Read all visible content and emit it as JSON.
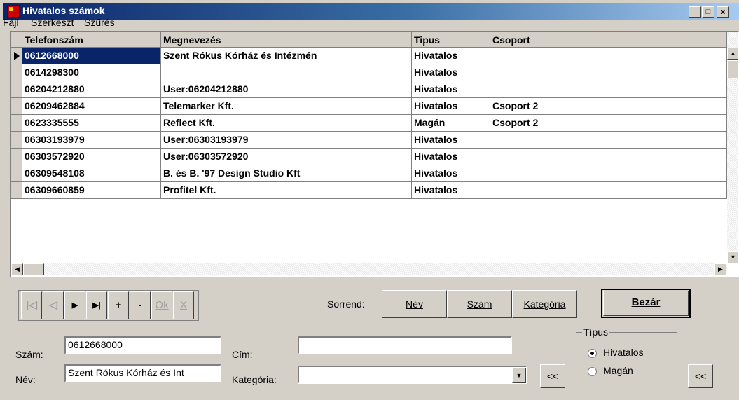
{
  "window": {
    "title": "Hivatalos számok"
  },
  "title_buttons": {
    "minimize": "_",
    "maximize": "□",
    "close": "x"
  },
  "menu": [
    "Fájl",
    "Szerkeszt",
    "Szűrés"
  ],
  "grid": {
    "headers": [
      "Telefonszám",
      "Megnevezés",
      "Tipus",
      "Csoport"
    ],
    "rows": [
      {
        "num": "0612668000",
        "name": "Szent Rókus Kórház és Intézmén",
        "type": "Hivatalos",
        "group": ""
      },
      {
        "num": "0614298300",
        "name": "",
        "type": "Hivatalos",
        "group": ""
      },
      {
        "num": "06204212880",
        "name": "User:06204212880",
        "type": "Hivatalos",
        "group": ""
      },
      {
        "num": "06209462884",
        "name": "Telemarker Kft.",
        "type": "Hivatalos",
        "group": "Csoport 2"
      },
      {
        "num": "0623335555",
        "name": "Reflect Kft.",
        "type": "Magán",
        "group": "Csoport 2"
      },
      {
        "num": "06303193979",
        "name": "User:06303193979",
        "type": "Hivatalos",
        "group": ""
      },
      {
        "num": "06303572920",
        "name": "User:06303572920",
        "type": "Hivatalos",
        "group": ""
      },
      {
        "num": "06309548108",
        "name": "B. és B. '97 Design Studio Kft",
        "type": "Hivatalos",
        "group": ""
      },
      {
        "num": "06309660859",
        "name": "Profitel Kft.",
        "type": "Hivatalos",
        "group": ""
      }
    ]
  },
  "nav": {
    "first": "|◁",
    "prev": "◁",
    "next": "▶",
    "last": "▶|",
    "add": "+",
    "remove": "-",
    "ok": "Ok",
    "cancel": "X"
  },
  "sort": {
    "label": "Sorrend:",
    "name": "Név",
    "number": "Szám",
    "category": "Kategória"
  },
  "close_button": "Bezár",
  "form": {
    "szam_label": "Szám:",
    "szam_value": "0612668000",
    "nev_label": "Név:",
    "nev_value": "Szent Rókus Kórház és Int",
    "cim_label": "Cím:",
    "cim_value": "",
    "kategoria_label": "Kategória:",
    "kategoria_value": "",
    "back_button": "<<"
  },
  "tipus": {
    "legend": "Típus",
    "options": [
      "Hivatalos",
      "Magán"
    ],
    "selected": "Hivatalos"
  }
}
